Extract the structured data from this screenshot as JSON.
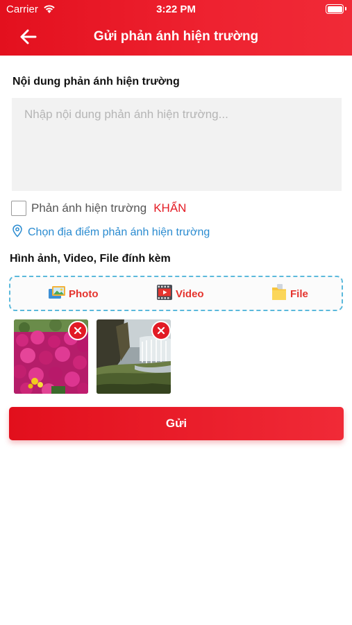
{
  "status_bar": {
    "carrier": "Carrier",
    "time": "3:22 PM"
  },
  "header": {
    "title": "Gửi phản ánh hiện trường",
    "back_icon": "arrow-left-icon"
  },
  "form": {
    "content_label": "Nội dung phản ánh hiện trường",
    "content_placeholder": "Nhập nội dung phản ánh hiện trường...",
    "content_value": "",
    "urgent_label": "Phản ánh hiện trường",
    "urgent_keyword": "KHẨN",
    "urgent_checked": false,
    "location_label": "Chọn địa điểm phản ánh hiện trường",
    "attachments_label": "Hình ảnh, Video, File đính kèm",
    "attach_options": [
      {
        "label": "Photo",
        "icon": "photo-icon"
      },
      {
        "label": "Video",
        "icon": "video-icon"
      },
      {
        "label": "File",
        "icon": "folder-icon"
      }
    ],
    "attachments": [
      {
        "subject": "flowers-photo"
      },
      {
        "subject": "waterfall-photo"
      }
    ],
    "submit_label": "Gửi"
  },
  "colors": {
    "brand_red": "#e3101e",
    "link_blue": "#2a8bd0",
    "dashed_border": "#5bb9dc"
  }
}
